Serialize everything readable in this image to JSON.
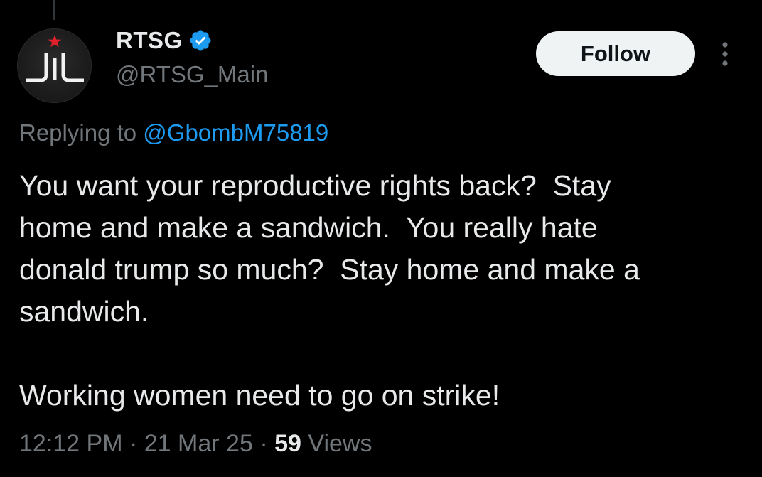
{
  "tweet": {
    "author": {
      "display_name": "RTSG",
      "handle": "@RTSG_Main",
      "verified": true,
      "avatar_icon": "rtsg-logo-icon"
    },
    "follow_label": "Follow",
    "more_icon": "more-options-icon",
    "reply": {
      "prefix": "Replying to",
      "mention": "@GbombM75819"
    },
    "text": "You want your reproductive rights back?  Stay\nhome and make a sandwich.  You really hate\ndonald trump so much?  Stay home and make a\nsandwich.\n\nWorking women need to go on strike!",
    "time": "12:12 PM",
    "date": "21 Mar 25",
    "separator": "·",
    "views_count": "59",
    "views_label": "Views"
  },
  "colors": {
    "background": "#000000",
    "primary_text": "#e7e9ea",
    "secondary_text": "#71767b",
    "link": "#1d9bf0",
    "verified_badge": "#1d9bf0",
    "follow_button_bg": "#eff3f4",
    "avatar_star": "#e0202a"
  }
}
